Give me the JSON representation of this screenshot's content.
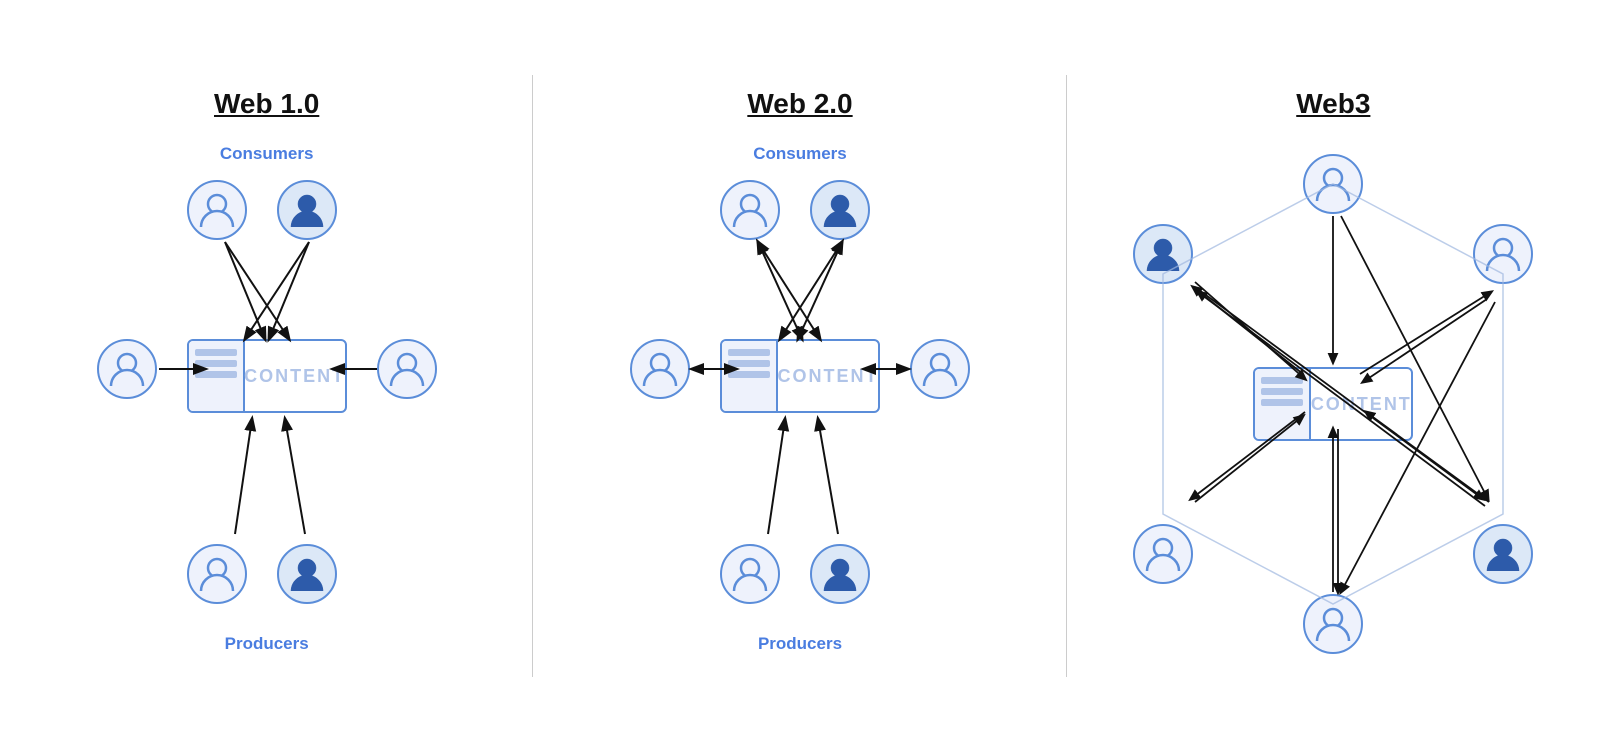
{
  "sections": [
    {
      "id": "web1",
      "title": "Web 1.0",
      "consumers_label": "Consumers",
      "producers_label": "Producers",
      "content_label": "CONTENT"
    },
    {
      "id": "web2",
      "title": "Web 2.0",
      "consumers_label": "Consumers",
      "producers_label": "Producers",
      "content_label": "CONTENT"
    },
    {
      "id": "web3",
      "title": "Web3",
      "content_label": "CONTENT"
    }
  ]
}
